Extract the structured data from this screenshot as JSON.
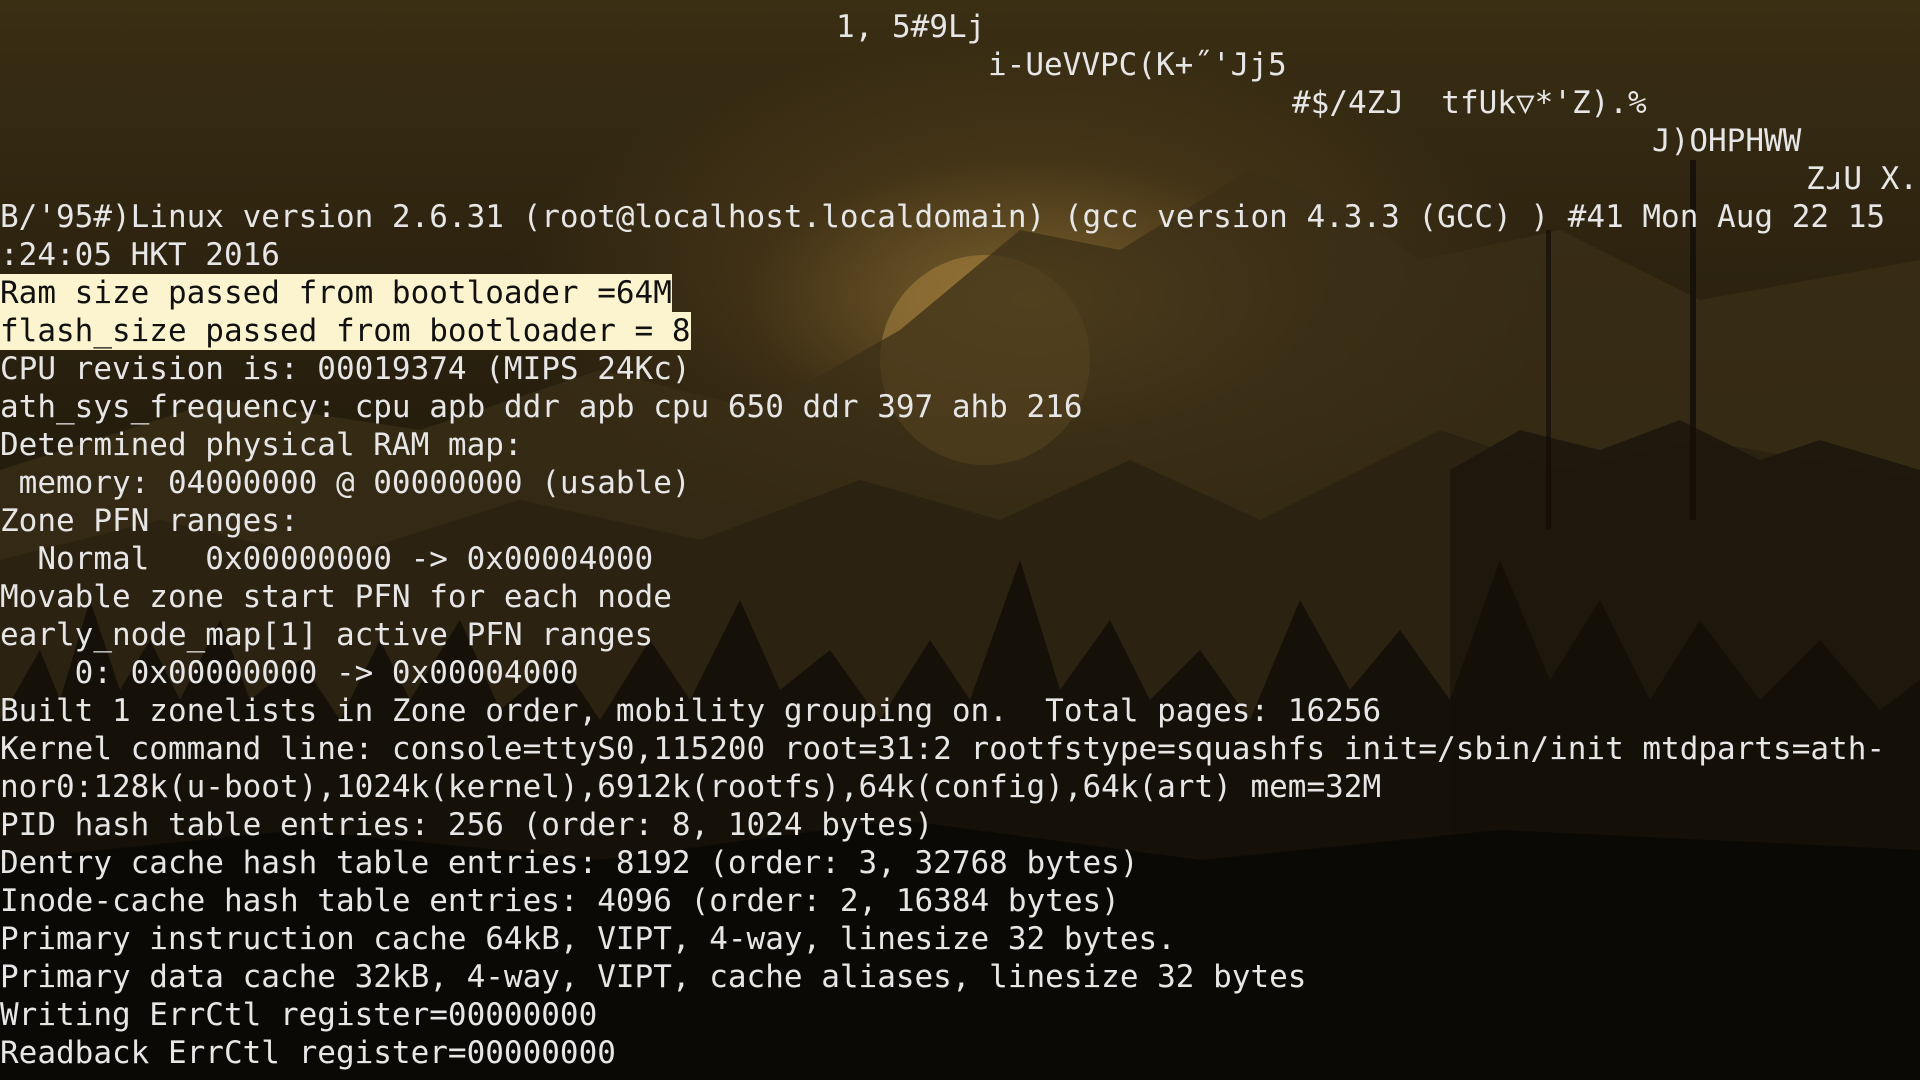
{
  "colors": {
    "terminal_text": "#e6e6e6",
    "highlight_bg": "#fbf4cf",
    "highlight_text": "#111111",
    "sky": "#3a2e13",
    "sun": "#b08d44"
  },
  "terminal": {
    "lines": [
      {
        "indent": "",
        "text": "1, 5#9Lj",
        "offset_cols": 0
      },
      {
        "indent": "",
        "text": "i-UeVVPC(K+˝'Jj5",
        "offset_cols": 0
      },
      {
        "indent": "",
        "text": "#$/4ZJ  tfUk▽*'Z).%",
        "offset_cols": 0
      },
      {
        "indent": "",
        "text": "J)OHPHWW",
        "offset_cols": 0
      },
      {
        "indent": "",
        "text": "ZɹU X.",
        "offset_cols": 0
      },
      {
        "text": "B/'95#)Linux version 2.6.31 (root@localhost.localdomain) (gcc version 4.3.3 (GCC) ) #41 Mon Aug 22 15"
      },
      {
        "text": ":24:05 HKT 2016"
      },
      {
        "text": "Ram size passed from bootloader =64M"
      },
      {
        "text": "flash_size passed from bootloader = 8"
      },
      {
        "text": "CPU revision is: 00019374 (MIPS 24Kc)"
      },
      {
        "text": "ath_sys_frequency: cpu apb ddr apb cpu 650 ddr 397 ahb 216"
      },
      {
        "text": "Determined physical RAM map:"
      },
      {
        "text": " memory: 04000000 @ 00000000 (usable)"
      },
      {
        "text": "Zone PFN ranges:"
      },
      {
        "text": "  Normal   0x00000000 -> 0x00004000"
      },
      {
        "text": "Movable zone start PFN for each node"
      },
      {
        "text": "early_node_map[1] active PFN ranges"
      },
      {
        "text": "    0: 0x00000000 -> 0x00004000"
      },
      {
        "text": "Built 1 zonelists in Zone order, mobility grouping on.  Total pages: 16256"
      },
      {
        "text": "Kernel command line: console=ttyS0,115200 root=31:2 rootfstype=squashfs init=/sbin/init mtdparts=ath-"
      },
      {
        "text": "nor0:128k(u-boot),1024k(kernel),6912k(rootfs),64k(config),64k(art) mem=32M"
      },
      {
        "text": "PID hash table entries: 256 (order: 8, 1024 bytes)"
      },
      {
        "text": "Dentry cache hash table entries: 8192 (order: 3, 32768 bytes)"
      },
      {
        "text": "Inode-cache hash table entries: 4096 (order: 2, 16384 bytes)"
      },
      {
        "text": "Primary instruction cache 64kB, VIPT, 4-way, linesize 32 bytes."
      },
      {
        "text": "Primary data cache 32kB, 4-way, VIPT, cache aliases, linesize 32 bytes"
      },
      {
        "text": "Writing ErrCtl register=00000000"
      },
      {
        "text": "Readback ErrCtl register=00000000"
      }
    ]
  }
}
